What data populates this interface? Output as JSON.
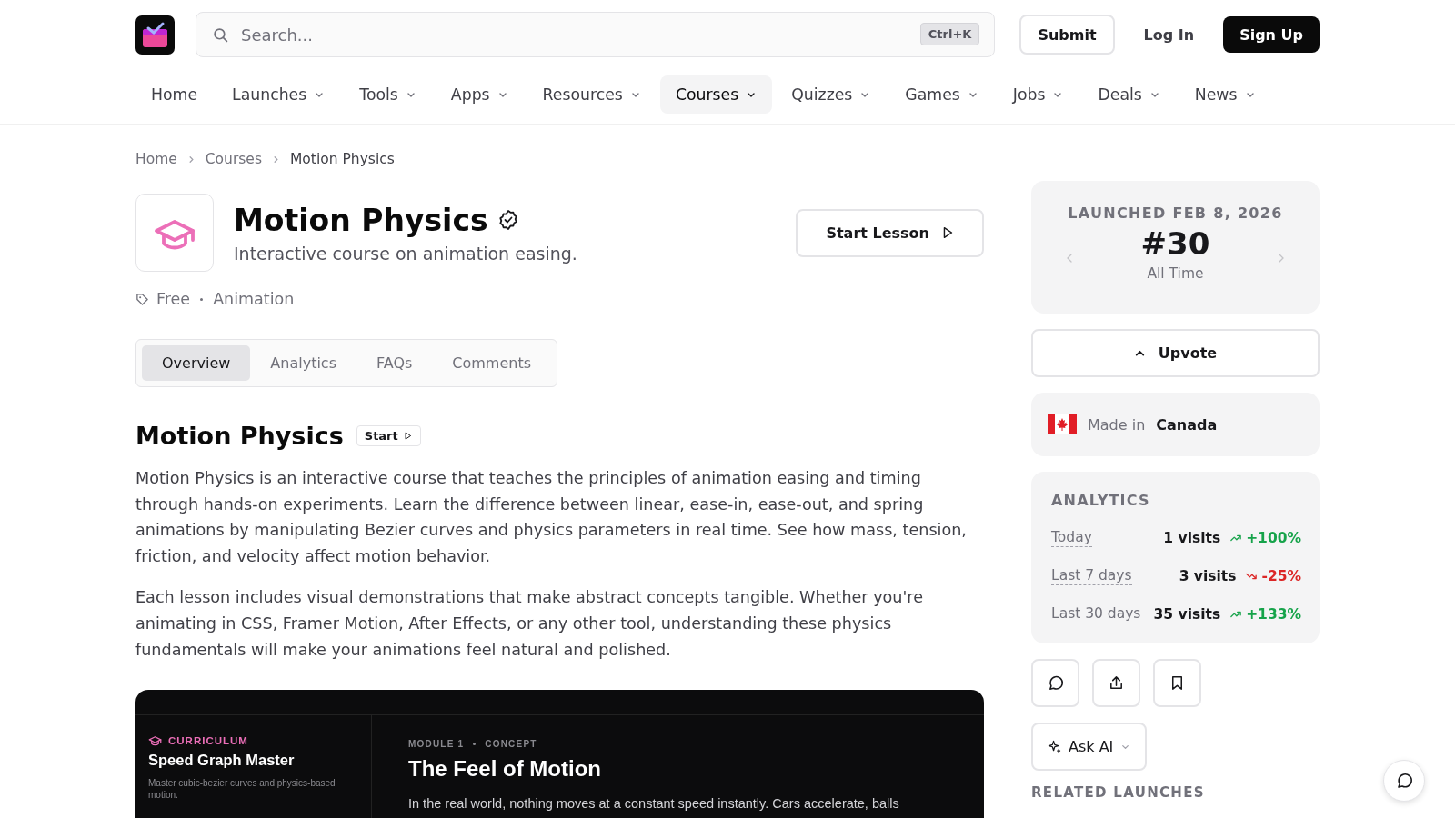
{
  "header": {
    "search": {
      "placeholder": "Search...",
      "shortcut": "Ctrl+K"
    },
    "buttons": [
      {
        "label": "Submit",
        "kind": "outline"
      },
      {
        "label": "Log In",
        "kind": "text"
      },
      {
        "label": "Sign Up",
        "kind": "solid"
      }
    ]
  },
  "nav": [
    {
      "label": "Home",
      "has_menu": false,
      "selected": false
    },
    {
      "label": "Launches",
      "has_menu": true,
      "selected": false
    },
    {
      "label": "Tools",
      "has_menu": true,
      "selected": false
    },
    {
      "label": "Apps",
      "has_menu": true,
      "selected": false
    },
    {
      "label": "Resources",
      "has_menu": true,
      "selected": false
    },
    {
      "label": "Courses",
      "has_menu": true,
      "selected": true
    },
    {
      "label": "Quizzes",
      "has_menu": true,
      "selected": false
    },
    {
      "label": "Games",
      "has_menu": true,
      "selected": false
    },
    {
      "label": "Jobs",
      "has_menu": true,
      "selected": false
    },
    {
      "label": "Deals",
      "has_menu": true,
      "selected": false
    },
    {
      "label": "News",
      "has_menu": true,
      "selected": false
    }
  ],
  "breadcrumb": [
    "Home",
    "Courses",
    "Motion Physics"
  ],
  "product": {
    "title": "Motion Physics",
    "verified": true,
    "tagline": "Interactive course on animation easing.",
    "action": "Start Lesson",
    "tags": [
      "Free",
      "Animation"
    ]
  },
  "tabs": [
    {
      "label": "Overview",
      "selected": true
    },
    {
      "label": "Analytics",
      "selected": false
    },
    {
      "label": "FAQs",
      "selected": false
    },
    {
      "label": "Comments",
      "selected": false
    }
  ],
  "overview": {
    "heading": "Motion Physics",
    "badge": "Start",
    "paragraphs": [
      "Motion Physics is an interactive course that teaches the principles of animation easing and timing through hands-on experiments. Learn the difference between linear, ease-in, ease-out, and spring animations by manipulating Bezier curves and physics parameters in real time. See how mass, tension, friction, and velocity affect motion behavior.",
      "Each lesson includes visual demonstrations that make abstract concepts tangible. Whether you're animating in CSS, Framer Motion, After Effects, or any other tool, understanding these physics fundamentals will make your animations feel natural and polished."
    ]
  },
  "preview": {
    "sidebar": {
      "eyebrow": "CURRICULUM",
      "title": "Speed Graph Master",
      "description": "Master cubic-bezier curves and physics-based motion."
    },
    "eyebrow": [
      "MODULE 1",
      "CONCEPT"
    ],
    "title": "The Feel of Motion",
    "text": "In the real world, nothing moves at a constant speed instantly. Cars accelerate, balls"
  },
  "launch": {
    "date": "LAUNCHED FEB 8, 2026",
    "rank": "#30",
    "period": "All Time"
  },
  "upvote": "Upvote",
  "origin": {
    "prefix": "Made in",
    "country": "Canada"
  },
  "analytics": {
    "title": "ANALYTICS",
    "rows": [
      {
        "period": "Today",
        "visits": "1 visits",
        "change": "+100%",
        "kind": "up"
      },
      {
        "period": "Last 7 days",
        "visits": "3 visits",
        "change": "-25%",
        "kind": "down"
      },
      {
        "period": "Last 30 days",
        "visits": "35 visits",
        "change": "+133%",
        "kind": "up"
      }
    ]
  },
  "ask_ai": "Ask AI",
  "related_heading": "RELATED LAUNCHES"
}
